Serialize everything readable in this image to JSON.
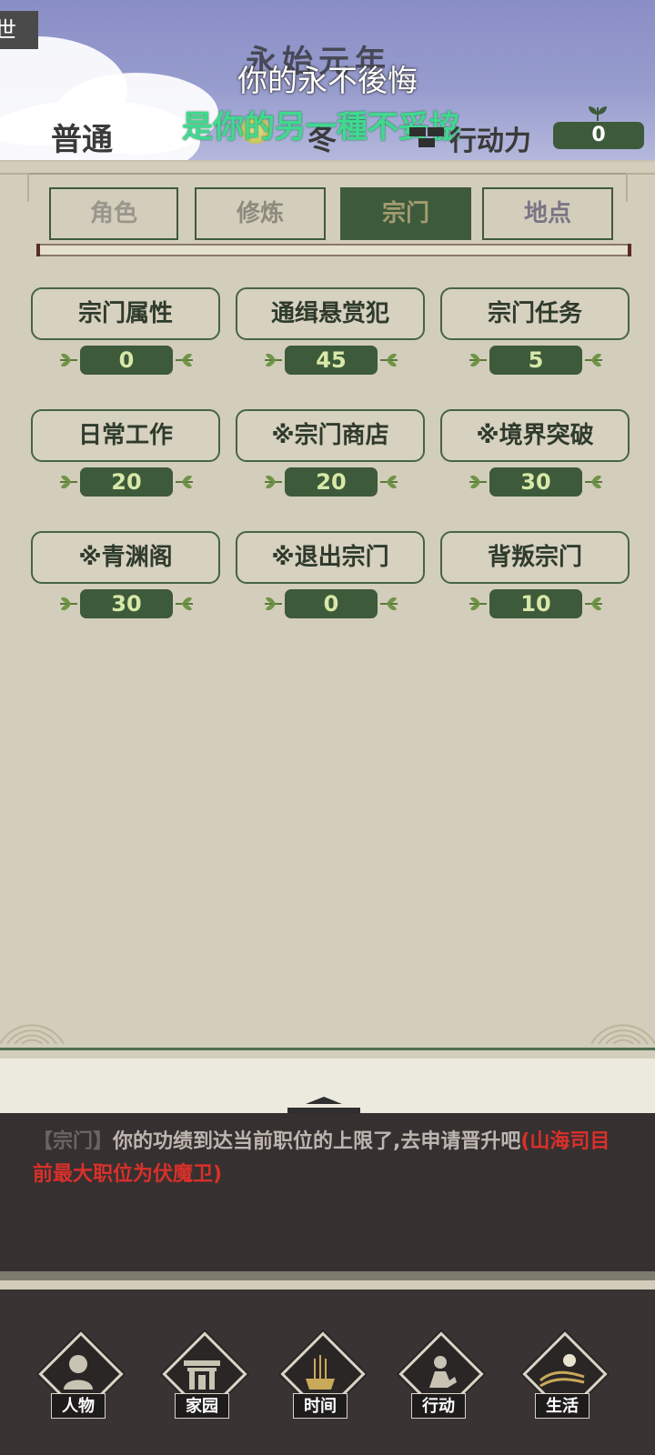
{
  "header": {
    "corner_tag": "世",
    "era": "永始元年",
    "lyric_line1": "你的永不後悔",
    "lyric_line2": "是你的另一種不妥協",
    "difficulty": "普通",
    "season": "冬",
    "action_points_label": "行动力",
    "action_points_value": "0"
  },
  "tabs": [
    {
      "label": "角色",
      "active": false
    },
    {
      "label": "修炼",
      "active": false
    },
    {
      "label": "宗门",
      "active": true
    },
    {
      "label": "地点",
      "active": false
    }
  ],
  "actions": [
    {
      "label": "宗门属性",
      "cost": "0"
    },
    {
      "label": "通缉悬赏犯",
      "cost": "45"
    },
    {
      "label": "宗门任务",
      "cost": "5"
    },
    {
      "label": "日常工作",
      "cost": "20"
    },
    {
      "label": "※宗门商店",
      "cost": "20"
    },
    {
      "label": "※境界突破",
      "cost": "30"
    },
    {
      "label": "※青渊阁",
      "cost": "30"
    },
    {
      "label": "※退出宗门",
      "cost": "0"
    },
    {
      "label": "背叛宗门",
      "cost": "10"
    }
  ],
  "message": {
    "tag": "【宗门】",
    "text": "你的功绩到达当前职位的上限了,去申请晋升吧",
    "highlight": "(山海司目前最大职位为伏魔卫)"
  },
  "nav": [
    {
      "label": "人物",
      "icon": "person-icon"
    },
    {
      "label": "家园",
      "icon": "gate-icon"
    },
    {
      "label": "时间",
      "icon": "incense-icon"
    },
    {
      "label": "行动",
      "icon": "action-icon"
    },
    {
      "label": "生活",
      "icon": "landscape-icon"
    }
  ],
  "colors": {
    "accent_green": "#3d5a3b",
    "cost_text": "#d8e8a8",
    "message_highlight": "#d9302b",
    "lyric_green": "#40d98f"
  }
}
